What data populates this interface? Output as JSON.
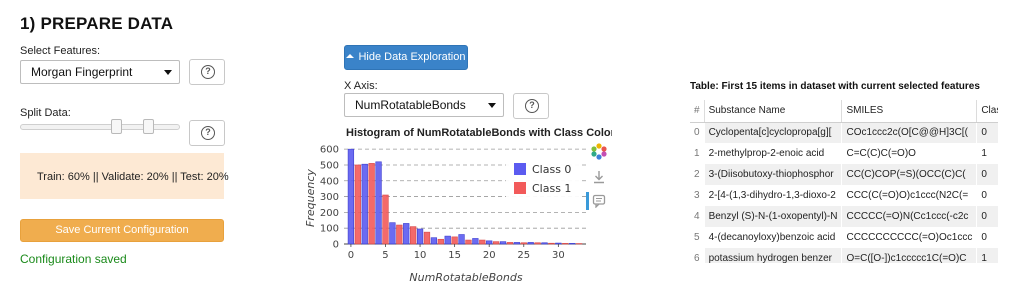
{
  "section": {
    "title": "1) PREPARE DATA"
  },
  "features": {
    "label": "Select Features:",
    "selected": "Morgan Fingerprint"
  },
  "split": {
    "label": "Split Data:",
    "train": 60,
    "validate": 20,
    "test": 20,
    "summary": "Train: 60% || Validate: 20% || Test: 20%"
  },
  "config": {
    "save_label": "Save Current Configuration",
    "status": "Configuration saved"
  },
  "exploration": {
    "toggle_label": "Hide Data Exploration",
    "xaxis_label": "X Axis:",
    "xaxis_selected": "NumRotatableBonds"
  },
  "help": {
    "symbol": "?"
  },
  "chart_data": {
    "type": "bar",
    "title": "Histogram of NumRotatableBonds with Class Color C",
    "xlabel": "NumRotatableBonds",
    "ylabel": "Frequency",
    "xlim": [
      -1,
      34
    ],
    "ylim": [
      0,
      620
    ],
    "xticks": [
      0,
      5,
      10,
      15,
      20,
      25,
      30
    ],
    "yticks": [
      0,
      100,
      200,
      300,
      400,
      500,
      600
    ],
    "grid": "horizontal dashed",
    "legend": "top-right",
    "colors": {
      "Class 0": "#5b5bf0",
      "Class 1": "#f25a5a"
    },
    "x": [
      0,
      1,
      2,
      3,
      4,
      5,
      6,
      7,
      8,
      9,
      10,
      11,
      12,
      13,
      14,
      15,
      16,
      17,
      18,
      19,
      20,
      21,
      22,
      23,
      24,
      25,
      26,
      27,
      28,
      29,
      30,
      31,
      32,
      33
    ],
    "series": [
      {
        "name": "Class 0",
        "values": [
          600,
          0,
          505,
          0,
          520,
          0,
          135,
          0,
          130,
          0,
          95,
          0,
          40,
          0,
          50,
          0,
          60,
          0,
          35,
          0,
          20,
          0,
          15,
          0,
          10,
          0,
          10,
          0,
          8,
          0,
          6,
          0,
          4,
          0
        ]
      },
      {
        "name": "Class 1",
        "values": [
          0,
          500,
          0,
          510,
          0,
          310,
          0,
          120,
          0,
          110,
          0,
          75,
          0,
          30,
          0,
          45,
          0,
          25,
          0,
          25,
          0,
          15,
          0,
          10,
          0,
          8,
          0,
          8,
          0,
          5,
          0,
          4,
          0,
          3
        ]
      }
    ]
  },
  "table": {
    "caption": "Table: First 15 items in dataset with current selected features",
    "columns": [
      "#",
      "Substance Name",
      "SMILES",
      "Class"
    ],
    "rows": [
      [
        "0",
        "Cyclopenta[c]cyclopropa[g][",
        "COc1ccc2c(O[C@@H]3C[(",
        "0"
      ],
      [
        "1",
        "2-methylprop-2-enoic acid",
        "C=C(C)C(=O)O",
        "1"
      ],
      [
        "2",
        "3-(Diisobutoxy-thiophosphor",
        "CC(C)COP(=S)(OCC(C)C(",
        "0"
      ],
      [
        "3",
        "2-[4-(1,3-dihydro-1,3-dioxo-2",
        "CCC(C(=O)O)c1ccc(N2C(=",
        "0"
      ],
      [
        "4",
        "Benzyl (S)-N-(1-oxopentyl)-N",
        "CCCCC(=O)N(Cc1ccc(-c2c",
        "0"
      ],
      [
        "5",
        "4-(decanoyloxy)benzoic acid",
        "CCCCCCCCCC(=O)Oc1ccc",
        "0"
      ],
      [
        "6",
        "potassium hydrogen benzer",
        "O=C([O-])c1ccccc1C(=O)C",
        "1"
      ]
    ]
  }
}
